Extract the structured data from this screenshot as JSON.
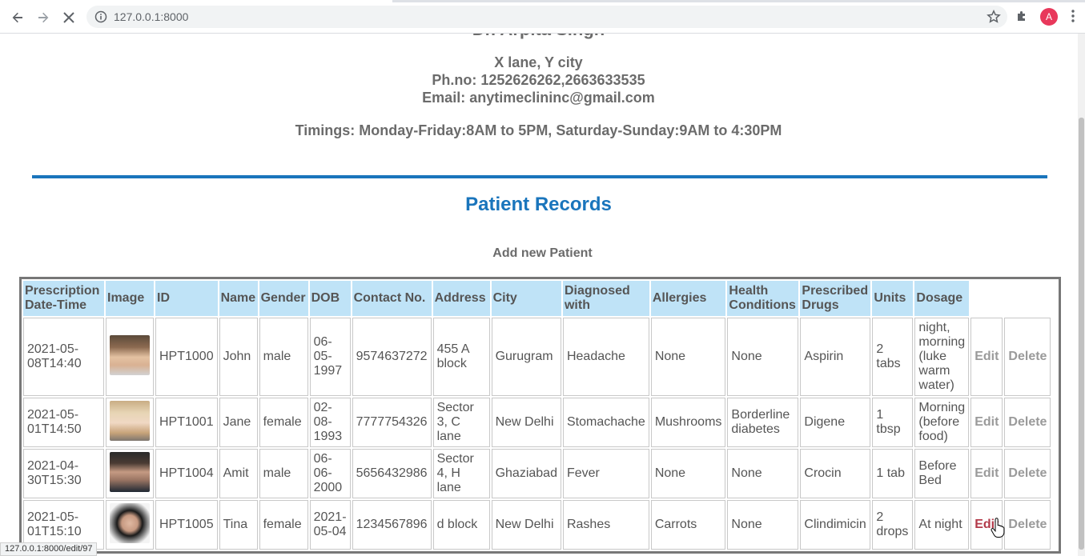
{
  "browser": {
    "url": "127.0.0.1:8000",
    "avatar_letter": "A",
    "status_url": "127.0.0.1:8000/edit/97"
  },
  "clinic": {
    "doctor_name": "Dr. Arpita Singh",
    "address": "X lane, Y city",
    "phone": "Ph.no: 1252626262,2663633535",
    "email": "Email: anytimeclininc@gmail.com",
    "timings": "Timings: Monday-Friday:8AM to 5PM, Saturday-Sunday:9AM to 4:30PM"
  },
  "records": {
    "title": "Patient Records",
    "add_link": "Add new Patient",
    "headers": {
      "date": "Prescription Date-Time",
      "image": "Image",
      "id": "ID",
      "name": "Name",
      "gender": "Gender",
      "dob": "DOB",
      "contact": "Contact No.",
      "address": "Address",
      "city": "City",
      "diagnosed": "Diagnosed with",
      "allergies": "Allergies",
      "health": "Health Conditions",
      "drugs": "Prescribed Drugs",
      "units": "Units",
      "dosage": "Dosage"
    },
    "actions": {
      "edit": "Edit",
      "delete": "Delete"
    },
    "rows": [
      {
        "date": "2021-05-08T14:40",
        "id": "HPT1000",
        "name": "John",
        "gender": "male",
        "dob": "06-05-1997",
        "contact": "9574637272",
        "address": "455 A block",
        "city": "Gurugram",
        "diagnosed": "Headache",
        "allergies": "None",
        "health": "None",
        "drugs": "Aspirin",
        "units": "2 tabs",
        "dosage": "night, morning (luke warm water)"
      },
      {
        "date": "2021-05-01T14:50",
        "id": "HPT1001",
        "name": "Jane",
        "gender": "female",
        "dob": "02-08-1993",
        "contact": "7777754326",
        "address": "Sector 3, C lane",
        "city": "New Delhi",
        "diagnosed": "Stomachache",
        "allergies": "Mushrooms",
        "health": "Borderline diabetes",
        "drugs": "Digene",
        "units": "1 tbsp",
        "dosage": "Morning (before food)"
      },
      {
        "date": "2021-04-30T15:30",
        "id": "HPT1004",
        "name": "Amit",
        "gender": "male",
        "dob": "06-06-2000",
        "contact": "5656432986",
        "address": "Sector 4, H lane",
        "city": "Ghaziabad",
        "diagnosed": "Fever",
        "allergies": "None",
        "health": "None",
        "drugs": "Crocin",
        "units": "1 tab",
        "dosage": "Before Bed"
      },
      {
        "date": "2021-05-01T15:10",
        "id": "HPT1005",
        "name": "Tina",
        "gender": "female",
        "dob": "2021-05-04",
        "contact": "1234567896",
        "address": "d block",
        "city": "New Delhi",
        "diagnosed": "Rashes",
        "allergies": "Carrots",
        "health": "None",
        "drugs": "Clindimicin",
        "units": "2 drops",
        "dosage": "At night"
      }
    ]
  },
  "colors": {
    "accent": "#1a75bc",
    "header_bg": "#bfe3f7",
    "text_gray": "#6b6b6b",
    "edit_hover": "#b33a4a"
  }
}
